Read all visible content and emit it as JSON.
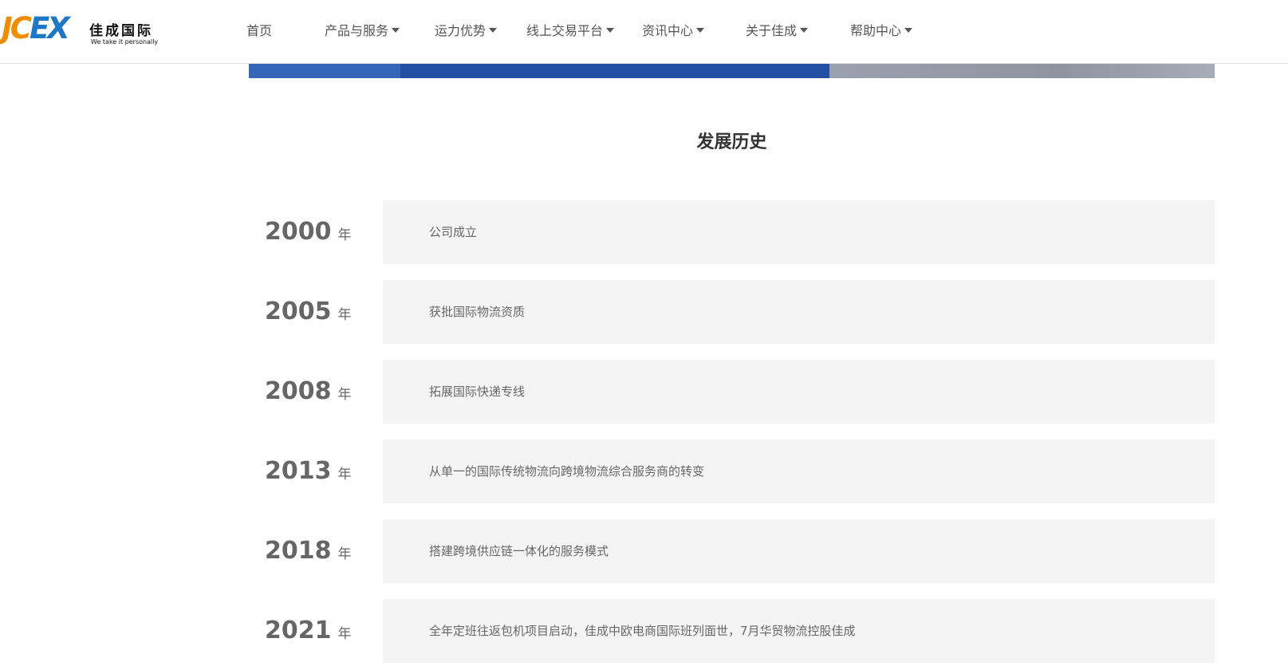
{
  "header": {
    "logo": {
      "mark_j": "J",
      "mark_c": "C",
      "mark_ex": "EX",
      "cn": "佳成国际",
      "en": "We take it personally"
    },
    "nav": [
      {
        "label": "首页",
        "has_dropdown": false
      },
      {
        "label": "产品与服务",
        "has_dropdown": true
      },
      {
        "label": "运力优势",
        "has_dropdown": true
      },
      {
        "label": "线上交易平台",
        "has_dropdown": true
      },
      {
        "label": "资讯中心",
        "has_dropdown": true
      },
      {
        "label": "关于佳成",
        "has_dropdown": true
      },
      {
        "label": "帮助中心",
        "has_dropdown": true
      }
    ]
  },
  "section": {
    "title": "发展历史"
  },
  "timeline": [
    {
      "year": "2000",
      "unit": "年",
      "text": "公司成立"
    },
    {
      "year": "2005",
      "unit": "年",
      "text": "获批国际物流资质"
    },
    {
      "year": "2008",
      "unit": "年",
      "text": "拓展国际快递专线"
    },
    {
      "year": "2013",
      "unit": "年",
      "text": "从单一的国际传统物流向跨境物流综合服务商的转变"
    },
    {
      "year": "2018",
      "unit": "年",
      "text": "搭建跨境供应链一体化的服务模式"
    },
    {
      "year": "2021",
      "unit": "年",
      "text": "全年定班往返包机项目启动，佳成中欧电商国际班列面世，7月华贸物流控股佳成"
    }
  ],
  "colors": {
    "accent_orange": "#f08c00",
    "accent_blue": "#1e78c8",
    "banner_blue": "#2450a3",
    "row_bg": "#f4f4f4"
  }
}
